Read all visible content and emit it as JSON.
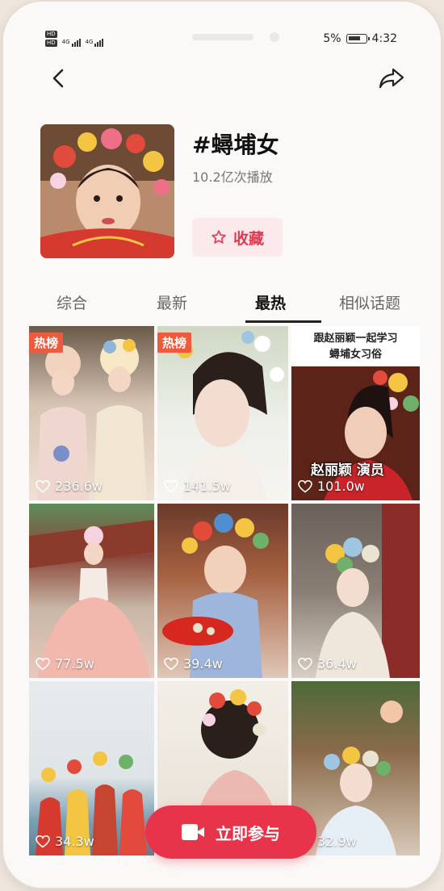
{
  "status_bar": {
    "hd_labels": [
      "HD",
      "HD"
    ],
    "network_labels": [
      "4G",
      "4G"
    ],
    "battery_percent": "5%",
    "time": "4:32"
  },
  "topic": {
    "title": "#蟳埔女",
    "plays": "10.2亿次播放",
    "favorite_label": "收藏"
  },
  "tabs": [
    {
      "label": "综合",
      "active": false
    },
    {
      "label": "最新",
      "active": false
    },
    {
      "label": "最热",
      "active": true
    },
    {
      "label": "相似话题",
      "active": false
    }
  ],
  "videos": [
    {
      "likes": "236.6w",
      "badge": "热榜"
    },
    {
      "likes": "141.5w",
      "badge": "热榜"
    },
    {
      "likes": "101.0w",
      "overlay_top": "跟赵丽颖一起学习\n蟳埔女习俗",
      "overlay_label": "赵丽颖 演员"
    },
    {
      "likes": "77.5w"
    },
    {
      "likes": "39.4w"
    },
    {
      "likes": "36.4w"
    },
    {
      "likes": "34.3w"
    },
    {
      "likes": ""
    },
    {
      "likes": "32.9w"
    }
  ],
  "join_button": {
    "label": "立即参与"
  },
  "icons": {
    "back": "chevron-left-icon",
    "share": "share-arrow-icon",
    "favorite": "star-outline-icon",
    "likes": "heart-outline-icon",
    "join": "video-camera-icon"
  },
  "colors": {
    "accent": "#e8344b",
    "fav_bg": "#fbe9ec",
    "badge": "#f05a3c"
  }
}
